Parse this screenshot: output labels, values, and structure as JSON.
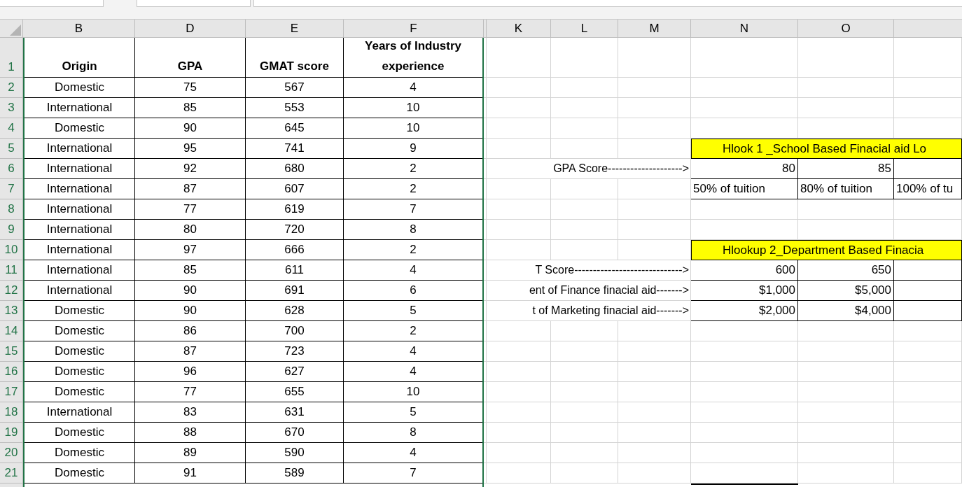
{
  "column_headers": [
    "B",
    "D",
    "E",
    "F",
    "K",
    "L",
    "M",
    "N",
    "O"
  ],
  "table": {
    "columns": [
      "Origin",
      "GPA",
      "GMAT score",
      "Years of Industry experience"
    ],
    "rows": [
      {
        "row_number": "2",
        "cells": [
          "Domestic",
          "75",
          "567",
          "4"
        ]
      },
      {
        "row_number": "3",
        "cells": [
          "International",
          "85",
          "553",
          "10"
        ]
      },
      {
        "row_number": "4",
        "cells": [
          "Domestic",
          "90",
          "645",
          "10"
        ]
      },
      {
        "row_number": "5",
        "cells": [
          "International",
          "95",
          "741",
          "9"
        ]
      },
      {
        "row_number": "6",
        "cells": [
          "International",
          "92",
          "680",
          "2"
        ]
      },
      {
        "row_number": "7",
        "cells": [
          "International",
          "87",
          "607",
          "2"
        ]
      },
      {
        "row_number": "8",
        "cells": [
          "International",
          "77",
          "619",
          "7"
        ]
      },
      {
        "row_number": "9",
        "cells": [
          "International",
          "80",
          "720",
          "8"
        ]
      },
      {
        "row_number": "10",
        "cells": [
          "International",
          "97",
          "666",
          "2"
        ]
      },
      {
        "row_number": "11",
        "cells": [
          "International",
          "85",
          "611",
          "4"
        ]
      },
      {
        "row_number": "12",
        "cells": [
          "International",
          "90",
          "691",
          "6"
        ]
      },
      {
        "row_number": "13",
        "cells": [
          "Domestic",
          "90",
          "628",
          "5"
        ]
      },
      {
        "row_number": "14",
        "cells": [
          "Domestic",
          "86",
          "700",
          "2"
        ]
      },
      {
        "row_number": "15",
        "cells": [
          "Domestic",
          "87",
          "723",
          "4"
        ]
      },
      {
        "row_number": "16",
        "cells": [
          "Domestic",
          "96",
          "627",
          "4"
        ]
      },
      {
        "row_number": "17",
        "cells": [
          "Domestic",
          "77",
          "655",
          "10"
        ]
      },
      {
        "row_number": "18",
        "cells": [
          "International",
          "83",
          "631",
          "5"
        ]
      },
      {
        "row_number": "19",
        "cells": [
          "Domestic",
          "88",
          "670",
          "8"
        ]
      },
      {
        "row_number": "20",
        "cells": [
          "Domestic",
          "89",
          "590",
          "4"
        ]
      },
      {
        "row_number": "21",
        "cells": [
          "Domestic",
          "91",
          "589",
          "7"
        ]
      }
    ]
  },
  "header_row_number": "1",
  "lookups": [
    {
      "title": "Hlook 1 _School Based Finacial aid Lo",
      "rows": [
        {
          "label": "GPA Score-------------------->",
          "values": [
            "80",
            "85"
          ]
        },
        {
          "label": "",
          "values": [
            "50% of tuition",
            "80% of tuition",
            "100% of tu"
          ]
        }
      ]
    },
    {
      "title": "Hlookup 2_Department Based Finacia",
      "rows": [
        {
          "label": "T Score----------------------------->",
          "values": [
            "600",
            "650"
          ]
        },
        {
          "label": "ent of Finance finacial aid------->",
          "values": [
            "$1,000",
            "$5,000"
          ]
        },
        {
          "label": "t of Marketing finacial aid------->",
          "values": [
            "$2,000",
            "$4,000"
          ]
        }
      ]
    }
  ]
}
